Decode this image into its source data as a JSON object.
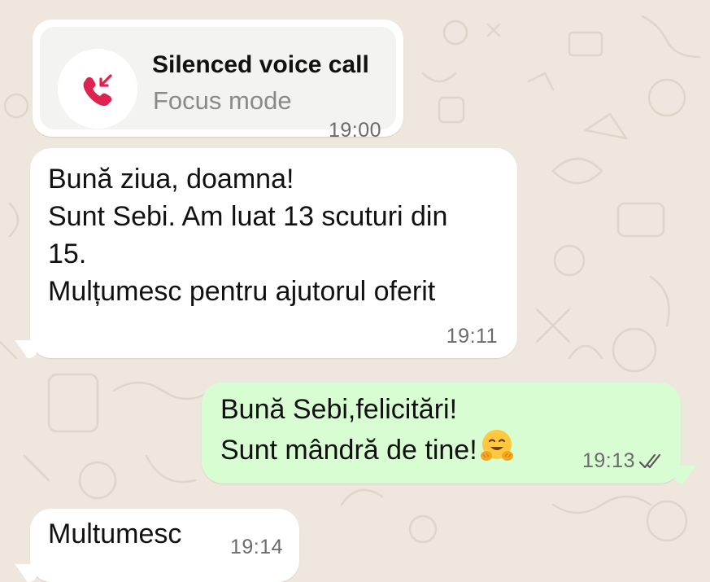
{
  "call": {
    "icon": "missed-call-icon",
    "icon_color": "#e0234e",
    "title": "Silenced voice call",
    "subtitle": "Focus mode",
    "time": "19:00"
  },
  "messages": [
    {
      "direction": "incoming",
      "lines": [
        "Bună ziua, doamna!",
        "Sunt Sebi. Am luat 13 scuturi din",
        "15.",
        "Mulțumesc pentru ajutorul oferit"
      ],
      "time": "19:11"
    },
    {
      "direction": "outgoing",
      "lines": [
        "Bună Sebi,felicitări!",
        "Sunt mândră de tine!"
      ],
      "emoji": "hugging-face-emoji",
      "time": "19:13",
      "status": "read-double-check-icon"
    },
    {
      "direction": "incoming",
      "lines": [
        "Multumesc"
      ],
      "time": "19:14"
    }
  ],
  "colors": {
    "background": "#efe7dd",
    "incoming_bubble": "#ffffff",
    "outgoing_bubble": "#d9fdd3",
    "timestamp": "#6b6b6b"
  }
}
